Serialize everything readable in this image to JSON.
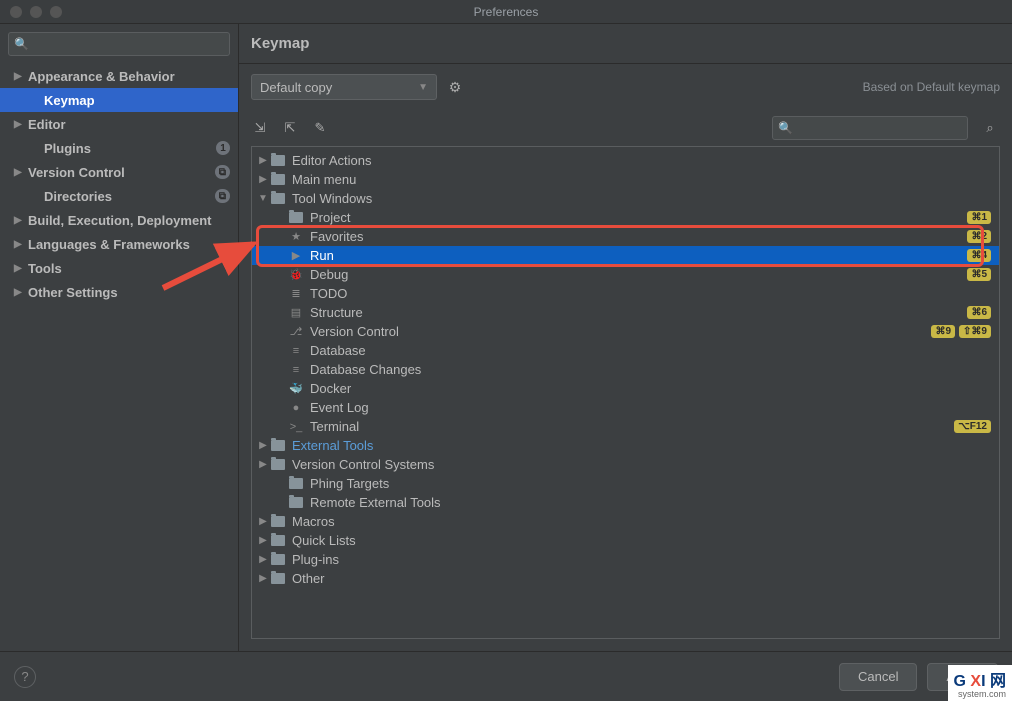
{
  "window": {
    "title": "Preferences"
  },
  "sidebar": {
    "search_placeholder": "",
    "items": [
      {
        "label": "Appearance & Behavior",
        "arrow": "▶",
        "indent": 0
      },
      {
        "label": "Keymap",
        "arrow": "",
        "indent": 1,
        "selected": true
      },
      {
        "label": "Editor",
        "arrow": "▶",
        "indent": 0
      },
      {
        "label": "Plugins",
        "arrow": "",
        "indent": 1,
        "badge": "1"
      },
      {
        "label": "Version Control",
        "arrow": "▶",
        "indent": 0,
        "badge": "⧉"
      },
      {
        "label": "Directories",
        "arrow": "",
        "indent": 1,
        "badge": "⧉"
      },
      {
        "label": "Build, Execution, Deployment",
        "arrow": "▶",
        "indent": 0
      },
      {
        "label": "Languages & Frameworks",
        "arrow": "▶",
        "indent": 0
      },
      {
        "label": "Tools",
        "arrow": "▶",
        "indent": 0
      },
      {
        "label": "Other Settings",
        "arrow": "▶",
        "indent": 0
      }
    ]
  },
  "content": {
    "title": "Keymap",
    "scheme": "Default copy",
    "based_on": "Based on Default keymap",
    "filter_placeholder": ""
  },
  "tree": [
    {
      "label": "Editor Actions",
      "level": 0,
      "arrow": "▶",
      "icon": "folder"
    },
    {
      "label": "Main menu",
      "level": 0,
      "arrow": "▶",
      "icon": "folder"
    },
    {
      "label": "Tool Windows",
      "level": 0,
      "arrow": "▼",
      "icon": "folder"
    },
    {
      "label": "Project",
      "level": 1,
      "icon": "folder",
      "shortcuts": [
        "⌘1"
      ]
    },
    {
      "label": "Favorites",
      "level": 1,
      "icon": "star",
      "shortcuts": [
        "⌘2"
      ]
    },
    {
      "label": "Run",
      "level": 1,
      "icon": "run",
      "shortcuts": [
        "⌘4"
      ],
      "selected": true
    },
    {
      "label": "Debug",
      "level": 1,
      "icon": "debug",
      "shortcuts": [
        "⌘5"
      ]
    },
    {
      "label": "TODO",
      "level": 1,
      "icon": "list",
      "shortcuts": []
    },
    {
      "label": "Structure",
      "level": 1,
      "icon": "struct",
      "shortcuts": [
        "⌘6"
      ]
    },
    {
      "label": "Version Control",
      "level": 1,
      "icon": "vcs",
      "shortcuts": [
        "⌘9",
        "⇧⌘9"
      ]
    },
    {
      "label": "Database",
      "level": 1,
      "icon": "db",
      "shortcuts": []
    },
    {
      "label": "Database Changes",
      "level": 1,
      "icon": "db",
      "shortcuts": []
    },
    {
      "label": "Docker",
      "level": 1,
      "icon": "docker",
      "shortcuts": []
    },
    {
      "label": "Event Log",
      "level": 1,
      "icon": "log",
      "shortcuts": []
    },
    {
      "label": "Terminal",
      "level": 1,
      "icon": "term",
      "shortcuts": [
        "⌥F12"
      ]
    },
    {
      "label": "External Tools",
      "level": 0,
      "arrow": "▶",
      "icon": "folder",
      "link": true
    },
    {
      "label": "Version Control Systems",
      "level": 0,
      "arrow": "▶",
      "icon": "folder"
    },
    {
      "label": "Phing Targets",
      "level": 1,
      "icon": "folder"
    },
    {
      "label": "Remote External Tools",
      "level": 1,
      "icon": "folder"
    },
    {
      "label": "Macros",
      "level": 0,
      "arrow": "▶",
      "icon": "folder"
    },
    {
      "label": "Quick Lists",
      "level": 0,
      "arrow": "▶",
      "icon": "folder"
    },
    {
      "label": "Plug-ins",
      "level": 0,
      "arrow": "▶",
      "icon": "folder"
    },
    {
      "label": "Other",
      "level": 0,
      "arrow": "▶",
      "icon": "folder"
    }
  ],
  "footer": {
    "cancel": "Cancel",
    "apply": "Apply"
  },
  "watermark": {
    "brand": "G XI",
    "suffix": "网",
    "sub": "system.com"
  }
}
